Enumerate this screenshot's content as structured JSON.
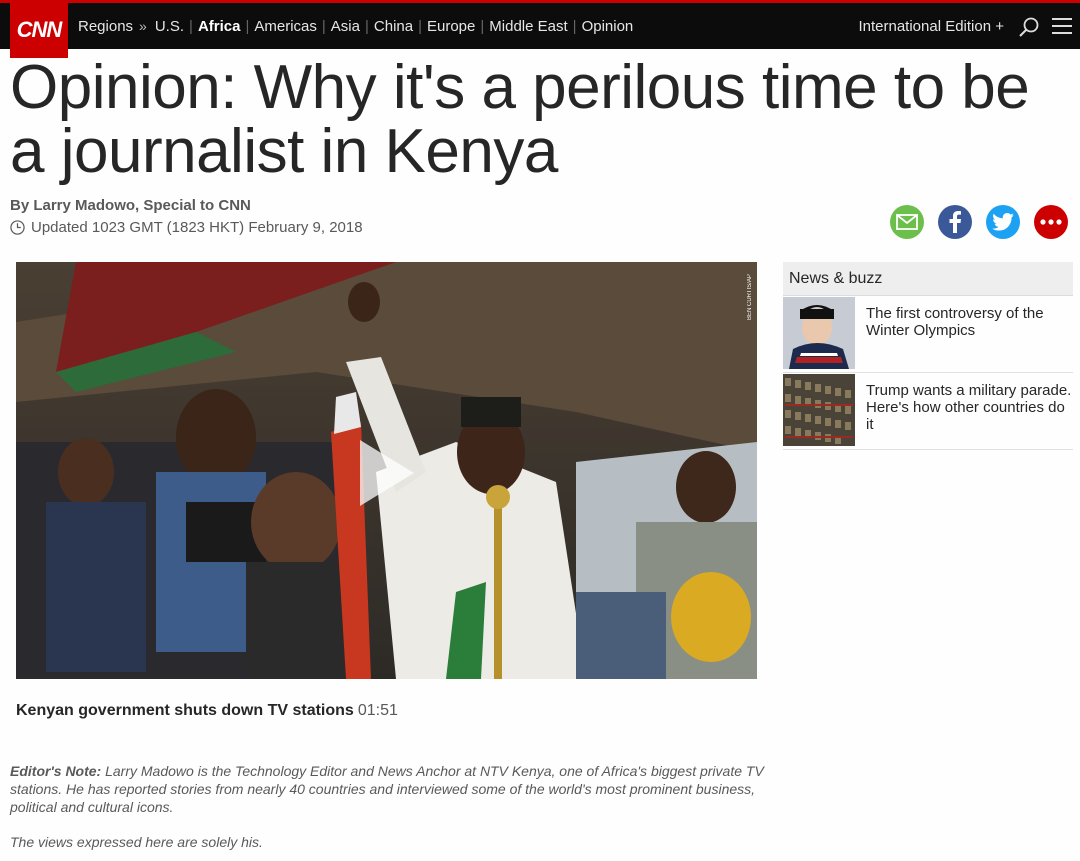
{
  "nav": {
    "logo": "CNN",
    "regions_label": "Regions",
    "arrow": "»",
    "links": [
      "U.S.",
      "Africa",
      "Americas",
      "Asia",
      "China",
      "Europe",
      "Middle East",
      "Opinion"
    ],
    "edition": "International Edition +"
  },
  "article": {
    "headline": "Opinion: Why it's a perilous time to be a journalist in Kenya",
    "byline": "By Larry Madowo, Special to CNN",
    "updated": "Updated 1023 GMT (1823 HKT) February 9, 2018"
  },
  "share": {
    "icons": [
      "email-icon",
      "facebook-icon",
      "twitter-icon",
      "more-icon"
    ],
    "colors": {
      "email": "#6bbf4a",
      "facebook": "#3b5998",
      "twitter": "#1da1f2",
      "more": "#cc0000"
    }
  },
  "video": {
    "credit": "BEN CURTIS/AP",
    "caption": "Kenyan government shuts down TV stations",
    "duration": "01:51"
  },
  "editor_note": {
    "label": "Editor's Note:",
    "text": "Larry Madowo is the Technology Editor and News Anchor at NTV Kenya, one of Africa's biggest private TV stations. He has reported stories from nearly 40 countries and interviewed some of the world's most prominent business, political and cultural icons.",
    "views": "The views expressed here are solely his."
  },
  "sidebar": {
    "title": "News & buzz",
    "items": [
      {
        "text": "The first controversy of the Winter Olympics"
      },
      {
        "text": "Trump wants a military parade. Here's how other countries do it"
      }
    ]
  },
  "colors": {
    "brand": "#cc0000",
    "nav_bg": "#0c0c0c"
  }
}
